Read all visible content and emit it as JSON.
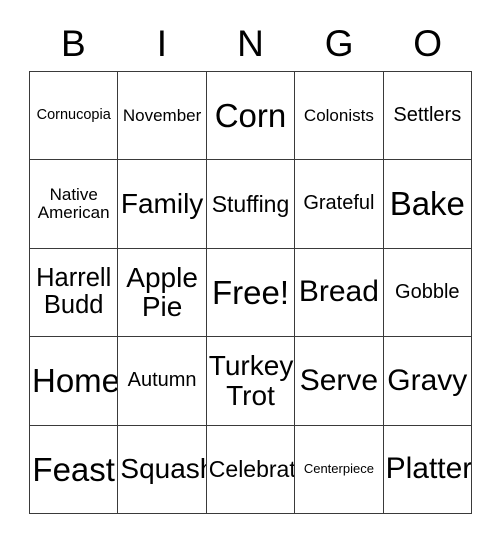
{
  "card": {
    "title_letters": [
      {
        "label": "B"
      },
      {
        "label": "I"
      },
      {
        "label": "N"
      },
      {
        "label": "G"
      },
      {
        "label": "O"
      }
    ],
    "colors": {
      "background": "#ffffff",
      "text": "#000000",
      "grid_line": "#3a3a3a"
    },
    "grid": {
      "columns": 5,
      "rows": 5,
      "free_space": "Free!",
      "cells": [
        [
          {
            "text": "Cornucopia",
            "size": "sm"
          },
          {
            "text": "November",
            "size": "md"
          },
          {
            "text": "Corn",
            "size": "5xl"
          },
          {
            "text": "Colonists",
            "size": "md"
          },
          {
            "text": "Settlers",
            "size": "lg"
          }
        ],
        [
          {
            "text": "Native\nAmerican",
            "size": "md"
          },
          {
            "text": "Family",
            "size": "3xl"
          },
          {
            "text": "Stuffing",
            "size": "xl"
          },
          {
            "text": "Grateful",
            "size": "lg"
          },
          {
            "text": "Bake",
            "size": "5xl"
          }
        ],
        [
          {
            "text": "Harrell\nBudd",
            "size": "2xl"
          },
          {
            "text": "Apple\nPie",
            "size": "3xl"
          },
          {
            "text": "Free!",
            "size": "5xl"
          },
          {
            "text": "Bread",
            "size": "4xl"
          },
          {
            "text": "Gobble",
            "size": "lg"
          }
        ],
        [
          {
            "text": "Home",
            "size": "5xl"
          },
          {
            "text": "Autumn",
            "size": "lg"
          },
          {
            "text": "Turkey\nTrot",
            "size": "3xl"
          },
          {
            "text": "Serve",
            "size": "4xl"
          },
          {
            "text": "Gravy",
            "size": "4xl"
          }
        ],
        [
          {
            "text": "Feast",
            "size": "5xl"
          },
          {
            "text": "Squash",
            "size": "3xl"
          },
          {
            "text": "Celebrate",
            "size": "xl"
          },
          {
            "text": "Centerpiece",
            "size": "xs"
          },
          {
            "text": "Platter",
            "size": "4xl"
          }
        ]
      ]
    }
  }
}
